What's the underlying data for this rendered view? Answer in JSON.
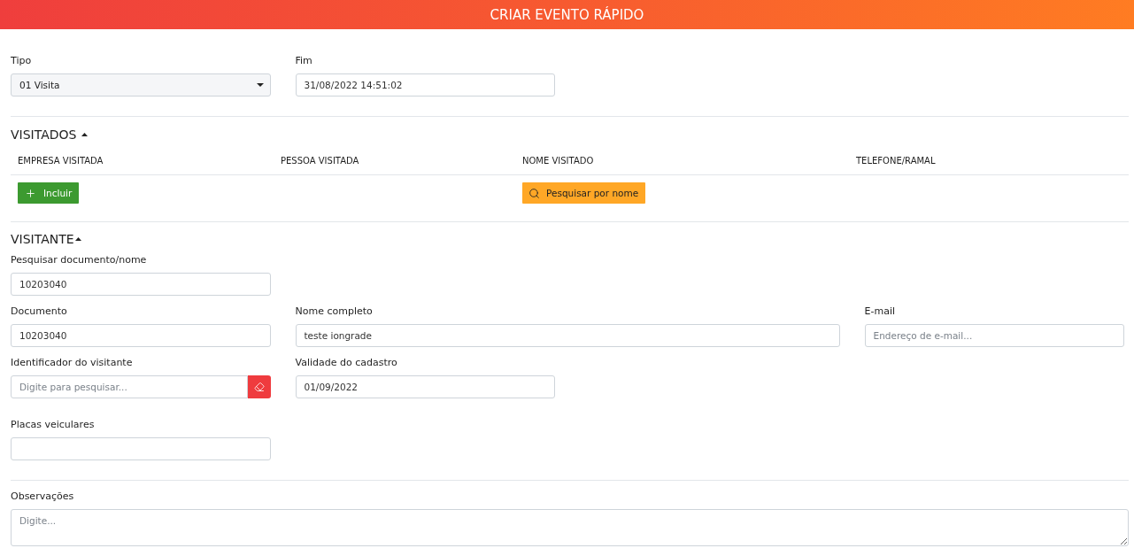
{
  "header": {
    "title": "CRIAR EVENTO RÁPIDO"
  },
  "event": {
    "fields": [
      {
        "kind": "select",
        "label": "Tipo",
        "value": "01 Visita"
      },
      {
        "kind": "text",
        "label": "Fim",
        "value": "31/08/2022 14:51:02"
      }
    ]
  },
  "visitados": {
    "title": "VISITADOS",
    "expanded": true,
    "columns": [
      "EMPRESA VISITADA",
      "PESSOA VISITADA",
      "NOME VISITADO",
      "TELEFONE/RAMAL"
    ],
    "actions": [
      {
        "kind": "add",
        "label": "Incluir"
      },
      {
        "kind": "search",
        "label": "Pesquisar por nome"
      }
    ]
  },
  "visitante": {
    "title": "VISITANTE",
    "expanded": true,
    "rows": [
      [
        {
          "kind": "text",
          "label": "Pesquisar documento/nome",
          "value": "10203040"
        }
      ],
      [
        {
          "kind": "text",
          "label": "Documento",
          "value": "10203040"
        },
        {
          "kind": "text",
          "label": "Nome completo",
          "value": "teste iongrade"
        },
        {
          "kind": "text",
          "label": "E-mail",
          "placeholder": "Endereço de e-mail..."
        }
      ],
      [
        {
          "kind": "lookup",
          "label": "Identificador do visitante",
          "placeholder": "Digite para pesquisar..."
        },
        {
          "kind": "text",
          "label": "Validade do cadastro",
          "value": "01/09/2022"
        }
      ],
      [
        {
          "kind": "text",
          "label": "Placas veiculares"
        }
      ]
    ]
  },
  "observacoes": {
    "label": "Observações",
    "placeholder": "Digite..."
  }
}
